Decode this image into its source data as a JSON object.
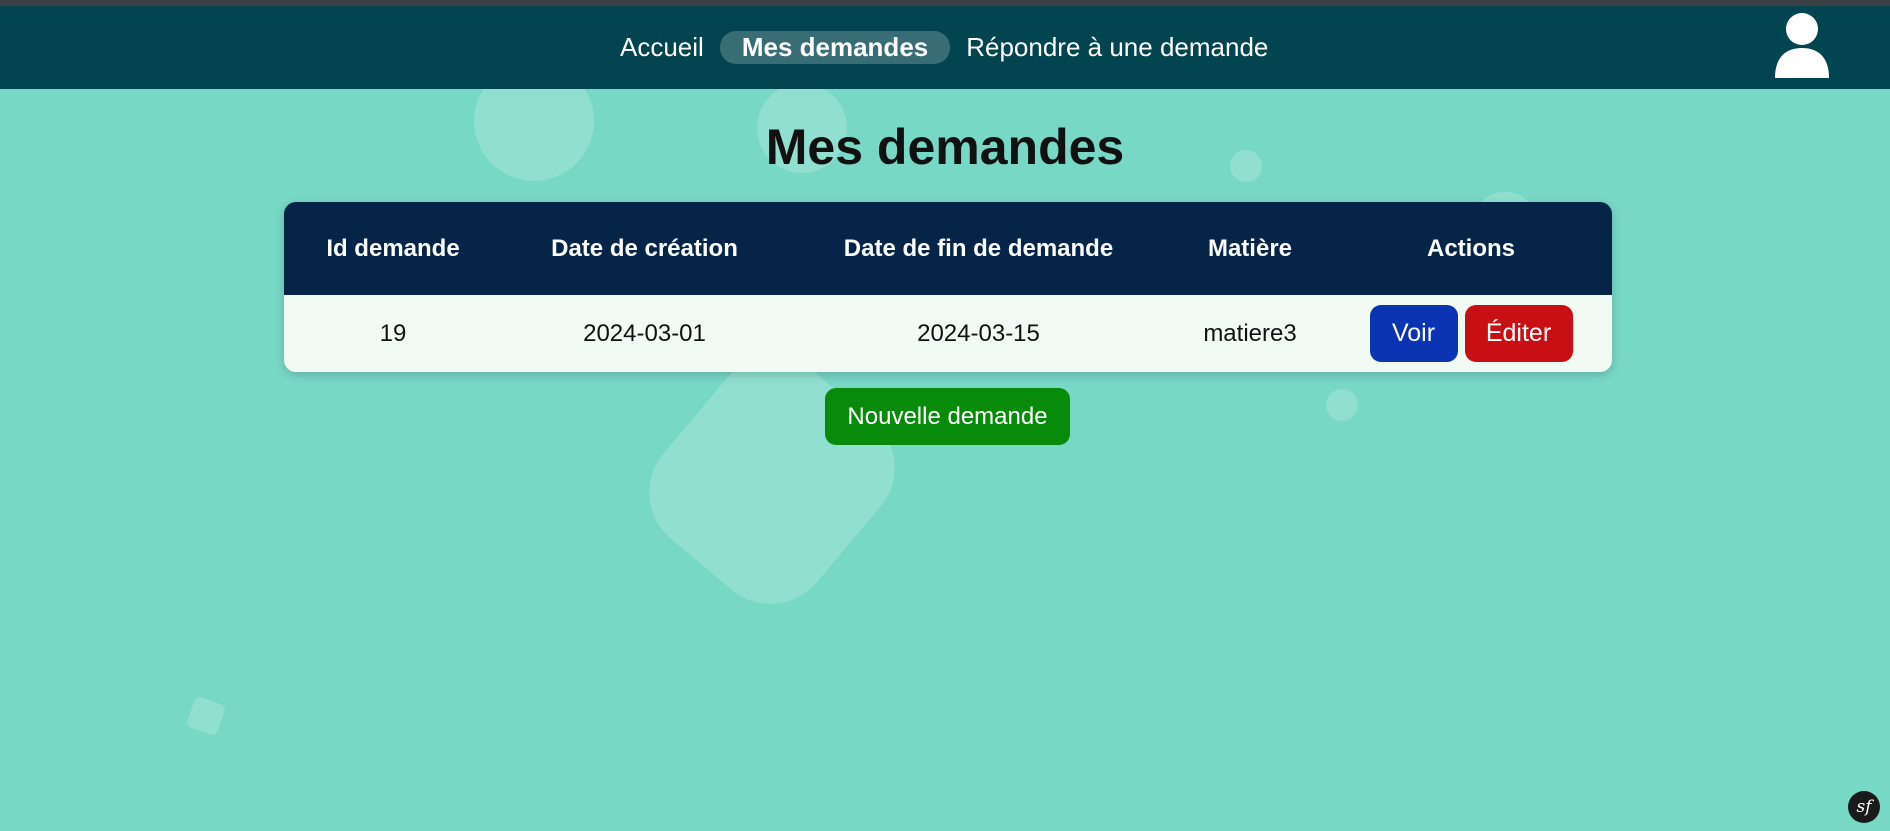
{
  "nav": {
    "items": [
      {
        "label": "Accueil",
        "active": false
      },
      {
        "label": "Mes demandes",
        "active": true
      },
      {
        "label": "Répondre à une demande",
        "active": false
      }
    ],
    "user_icon": "user-icon"
  },
  "page": {
    "title": "Mes demandes"
  },
  "table": {
    "headers": [
      "Id demande",
      "Date de création",
      "Date de fin de demande",
      "Matière",
      "Actions"
    ],
    "rows": [
      {
        "id": "19",
        "created": "2024-03-01",
        "end": "2024-03-15",
        "subject": "matiere3",
        "actions": {
          "view": "Voir",
          "edit": "Éditer"
        }
      }
    ]
  },
  "new_request_label": "Nouvelle demande",
  "footer_logo": "symfony-logo-icon",
  "colors": {
    "background": "#78d8c6",
    "navbar": "#02444f",
    "table_header": "#052448",
    "voir": "#0b34b2",
    "editer": "#c80f14",
    "new_button": "#088a0b"
  }
}
